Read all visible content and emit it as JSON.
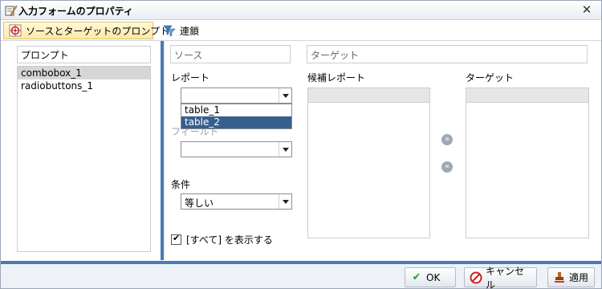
{
  "window": {
    "title": "入力フォームのプロパティ"
  },
  "tabs": [
    {
      "label": "ソースとターゲットのプロンプト",
      "active": true,
      "icon": "target-icon"
    },
    {
      "label": "連鎖",
      "active": false,
      "icon": "chain-filter-icon"
    }
  ],
  "prompts": {
    "header": "プロンプト",
    "items": [
      "combobox_1",
      "radiobuttons_1"
    ],
    "selected": "combobox_1"
  },
  "source": {
    "field_placeholder": "ソース",
    "report_label": "レポート",
    "report_value": "",
    "report_options": [
      "table_1",
      "table_2"
    ],
    "report_selected_option": "table_2",
    "field_label": "フィールド",
    "field_value": "",
    "condition_label": "条件",
    "condition_value": "等しい",
    "show_all_label": "[すべて] を表示する",
    "show_all_checked": true
  },
  "target": {
    "field_placeholder": "ターゲット",
    "candidate_label": "候補レポート",
    "target_label": "ターゲット",
    "add_icon": "double-chevron-right-icon",
    "remove_icon": "double-chevron-left-icon"
  },
  "footer": {
    "ok_label": "OK",
    "cancel_label": "キャンセル",
    "apply_label": "適用"
  },
  "colors": {
    "accent_blue": "#4a7ab8",
    "selected_option": "#35608c",
    "active_tab": "#ffe9a8"
  }
}
